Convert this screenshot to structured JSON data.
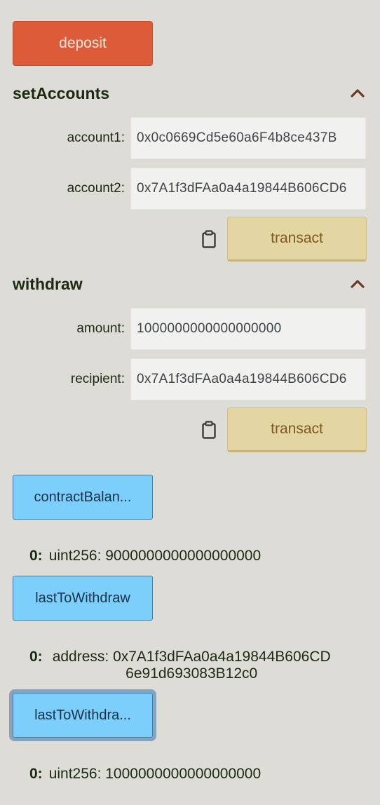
{
  "deposit": {
    "label": "deposit"
  },
  "set_accounts": {
    "title": "setAccounts",
    "collapse_icon": "chevron-up-icon",
    "args": [
      {
        "label": "account1:",
        "value": "0x0c0669Cd5e60a6F4b8ce437B"
      },
      {
        "label": "account2:",
        "value": "0x7A1f3dFAa0a4a19844B606CD6"
      }
    ],
    "copy_icon": "clipboard-icon",
    "transact_label": "transact"
  },
  "withdraw": {
    "title": "withdraw",
    "collapse_icon": "chevron-up-icon",
    "args": [
      {
        "label": "amount:",
        "value": "1000000000000000000"
      },
      {
        "label": "recipient:",
        "value": "0x7A1f3dFAa0a4a19844B606CD6"
      }
    ],
    "copy_icon": "clipboard-icon",
    "transact_label": "transact"
  },
  "calls": [
    {
      "label": "contractBalan...",
      "result": {
        "index": "0:",
        "text": "uint256: 9000000000000000000"
      }
    },
    {
      "label": "lastToWithdraw",
      "result": {
        "index": "0:",
        "line1": "address: 0x7A1f3dFAa0a4a19844B606CD",
        "line2": "6e91d693083B12c0"
      }
    },
    {
      "label": "lastToWithdra...",
      "result": {
        "index": "0:",
        "text": "uint256: 1000000000000000000"
      }
    }
  ],
  "colors": {
    "background": "#dddcd7",
    "deposit": "#dc5b38",
    "transact": "#e4d6a2",
    "call": "#7ccffa"
  }
}
